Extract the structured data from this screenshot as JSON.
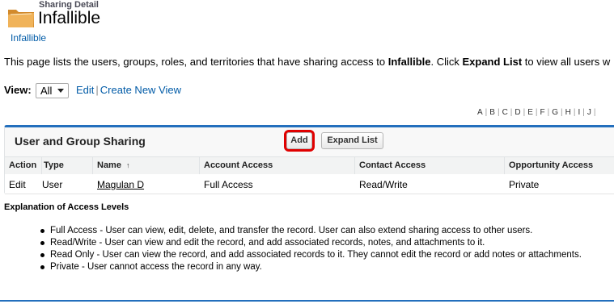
{
  "header": {
    "page_type": "Sharing Detail",
    "title": "Infallible",
    "breadcrumb": "Infallible"
  },
  "description": {
    "prefix": "This page lists the users, groups, roles, and territories that have sharing access to ",
    "record_name": "Infallible",
    "middle": ". Click ",
    "expand_word": "Expand List",
    "suffix": " to view all users w"
  },
  "view": {
    "label": "View:",
    "selected": "All",
    "edit_link": "Edit",
    "separator": "|",
    "create_link": "Create New View"
  },
  "alpha_filter": [
    "A",
    "B",
    "C",
    "D",
    "E",
    "F",
    "G",
    "H",
    "I",
    "J"
  ],
  "panel": {
    "title": "User and Group Sharing",
    "add_button": "Add",
    "expand_button": "Expand List"
  },
  "table": {
    "headers": {
      "action": "Action",
      "type": "Type",
      "name": "Name",
      "name_sort": "↑",
      "account_access": "Account Access",
      "contact_access": "Contact Access",
      "opportunity_access": "Opportunity Access"
    },
    "rows": [
      {
        "action": "Edit",
        "type": "User",
        "name": "Magulan D",
        "account_access": "Full Access",
        "contact_access": "Read/Write",
        "opportunity_access": "Private"
      }
    ]
  },
  "explanation": {
    "title": "Explanation of Access Levels",
    "items": [
      "Full Access - User can view, edit, delete, and transfer the record. User can also extend sharing access to other users.",
      "Read/Write - User can view and edit the record, and add associated records, notes, and attachments to it.",
      "Read Only - User can view the record, and add associated records to it. They cannot edit the record or add notes or attachments.",
      "Private - User cannot access the record in any way."
    ]
  },
  "colors": {
    "accent": "#236fbd",
    "link": "#015ba7",
    "highlight": "#e00000",
    "folder": "#e8a64a"
  }
}
